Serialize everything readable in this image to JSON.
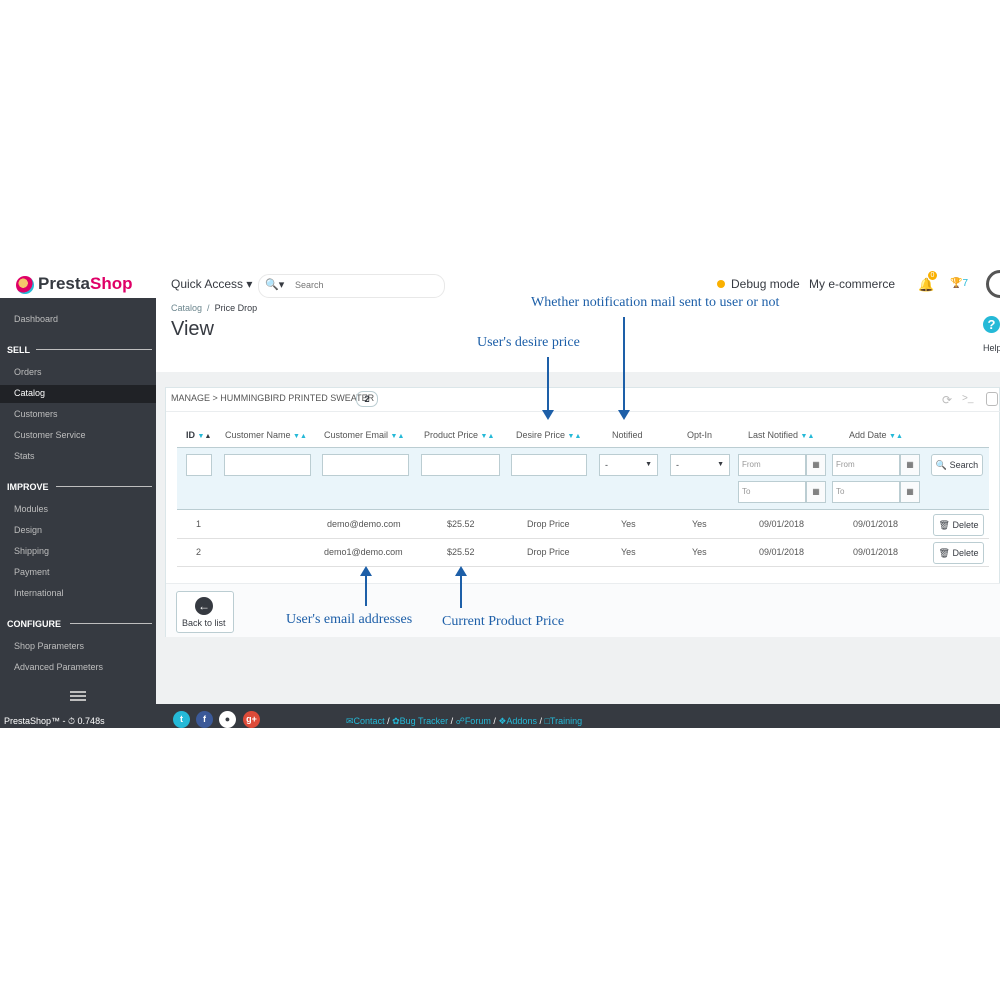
{
  "brand": {
    "name_part1": "Presta",
    "name_part2": "Shop"
  },
  "header": {
    "quick_access": "Quick Access ▾",
    "search_placeholder": "Search",
    "debug_mode": "Debug mode",
    "shop_name": "My e-commerce",
    "notif_count": "0",
    "trophy_count": "7"
  },
  "sidebar": {
    "dashboard": "Dashboard",
    "sections": [
      "SELL",
      "IMPROVE",
      "CONFIGURE"
    ],
    "sell": [
      "Orders",
      "Catalog",
      "Customers",
      "Customer Service",
      "Stats"
    ],
    "improve": [
      "Modules",
      "Design",
      "Shipping",
      "Payment",
      "International"
    ],
    "configure": [
      "Shop Parameters",
      "Advanced Parameters"
    ]
  },
  "breadcrumb": {
    "parent": "Catalog",
    "sep": "/",
    "current": "Price Drop"
  },
  "page_title": "View",
  "help_label": "Help",
  "panel": {
    "heading": "MANAGE > HUMMINGBIRD PRINTED SWEATER",
    "count": "2",
    "columns": [
      "ID",
      "Customer Name",
      "Customer Email",
      "Product Price",
      "Desire Price",
      "Notified",
      "Opt-In",
      "Last Notified",
      "Add Date"
    ],
    "filters": {
      "notified_select": "-",
      "optin_select": "-",
      "from": "From",
      "to": "To",
      "search_button": "Search"
    },
    "rows": [
      {
        "id": "1",
        "name": "",
        "email": "demo@demo.com",
        "product_price": "$25.52",
        "desire_price": "Drop Price",
        "notified": "Yes",
        "optin": "Yes",
        "last_notified": "09/01/2018",
        "add_date": "09/01/2018"
      },
      {
        "id": "2",
        "name": "",
        "email": "demo1@demo.com",
        "product_price": "$25.52",
        "desire_price": "Drop Price",
        "notified": "Yes",
        "optin": "Yes",
        "last_notified": "09/01/2018",
        "add_date": "09/01/2018"
      }
    ],
    "delete_label": "Delete",
    "back_label": "Back to list"
  },
  "annotations": {
    "notified": "Whether notification mail sent to user or not",
    "desire": "User's desire price",
    "email": "User's email addresses",
    "price": "Current Product Price"
  },
  "footer": {
    "version": "PrestaShop™ - ⏱ 0.748s",
    "links": [
      "Contact",
      "Bug Tracker",
      "Forum",
      "Addons",
      "Training"
    ]
  },
  "colors": {
    "sidebar": "#363a41",
    "accent": "#25b9d7",
    "brand_pink": "#df0067",
    "annotation": "#1d5fa8"
  }
}
